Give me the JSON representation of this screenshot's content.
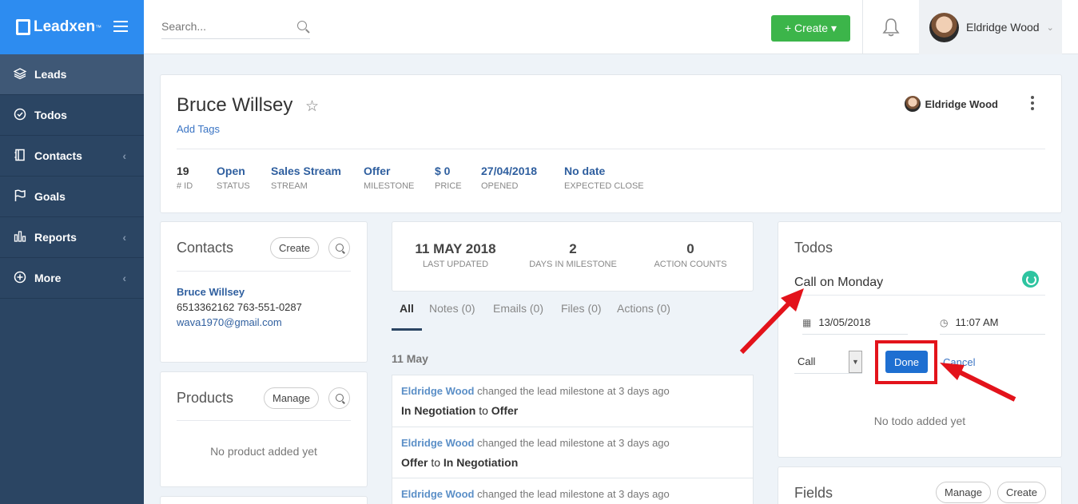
{
  "brand": {
    "name": "Leadxen",
    "tm": "™"
  },
  "search": {
    "placeholder": "Search..."
  },
  "header": {
    "create_label": "+ Create ▾",
    "user_name": "Eldridge Wood"
  },
  "sidebar": {
    "items": [
      {
        "label": "Leads",
        "icon": "layers-icon"
      },
      {
        "label": "Todos",
        "icon": "check-circle-icon"
      },
      {
        "label": "Contacts",
        "icon": "address-book-icon"
      },
      {
        "label": "Goals",
        "icon": "flag-icon"
      },
      {
        "label": "Reports",
        "icon": "bar-chart-icon"
      },
      {
        "label": "More",
        "icon": "plus-circle-icon"
      }
    ]
  },
  "lead": {
    "name": "Bruce Willsey",
    "add_tags": "Add Tags",
    "owner": "Eldridge Wood",
    "stats": [
      {
        "value": "19",
        "label": "# ID"
      },
      {
        "value": "Open",
        "label": "STATUS"
      },
      {
        "value": "Sales Stream",
        "label": "STREAM"
      },
      {
        "value": "Offer",
        "label": "MILESTONE"
      },
      {
        "value": "$ 0",
        "label": "PRICE"
      },
      {
        "value": "27/04/2018",
        "label": "OPENED"
      },
      {
        "value": "No date",
        "label": "EXPECTED CLOSE"
      }
    ]
  },
  "contacts": {
    "title": "Contacts",
    "create_label": "Create",
    "name": "Bruce Willsey",
    "phones": "6513362162 763-551-0287",
    "email": "wava1970@gmail.com"
  },
  "products": {
    "title": "Products",
    "manage_label": "Manage",
    "empty": "No product added yet"
  },
  "milestone_stats": [
    {
      "value": "11 MAY 2018",
      "label": "LAST UPDATED"
    },
    {
      "value": "2",
      "label": "DAYS IN MILESTONE"
    },
    {
      "value": "0",
      "label": "ACTION COUNTS"
    }
  ],
  "tabs": [
    "All",
    "Notes (0)",
    "Emails (0)",
    "Files (0)",
    "Actions (0)"
  ],
  "activity": {
    "date": "11 May",
    "items": [
      {
        "actor": "Eldridge Wood",
        "text": " changed the lead milestone at 3 days ago",
        "from": "In Negotiation",
        "to_word": " to ",
        "to": "Offer"
      },
      {
        "actor": "Eldridge Wood",
        "text": " changed the lead milestone at 3 days ago",
        "from": "Offer",
        "to_word": " to ",
        "to": "In Negotiation"
      },
      {
        "actor": "Eldridge Wood",
        "text": " changed the lead milestone at 3 days ago",
        "from": "",
        "to_word": "",
        "to": ""
      }
    ]
  },
  "todos": {
    "title": "Todos",
    "todo_text": "Call on Monday",
    "date": "13/05/2018",
    "time": "11:07 AM",
    "type": "Call",
    "done_label": "Done",
    "cancel_label": "Cancel",
    "empty": "No todo added yet"
  },
  "fields": {
    "title": "Fields",
    "manage_label": "Manage",
    "create_label": "Create"
  },
  "colors": {
    "brand_blue": "#2d8cf0",
    "sidebar": "#2b4563",
    "create_green": "#3cb54a",
    "done_blue": "#1e6fd1",
    "annotation_red": "#e3131b"
  }
}
